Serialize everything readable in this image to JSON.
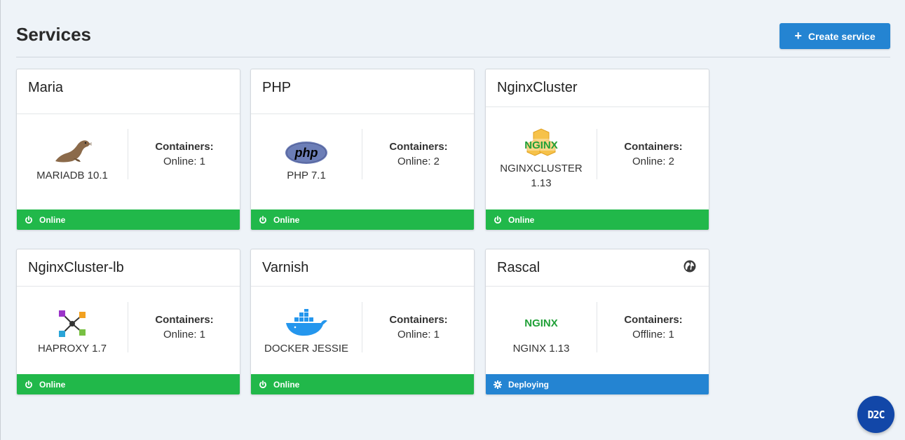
{
  "page": {
    "title": "Services"
  },
  "toolbar": {
    "create_label": "Create service",
    "create_icon": "plus-icon"
  },
  "colors": {
    "online": "#21b84a",
    "deploying": "#2484d2",
    "accent": "#2484d2",
    "fab": "#1247a8"
  },
  "cards": [
    {
      "title": "Maria",
      "logo_label": "MARIADB 10.1",
      "logo_icon": "mariadb-seal-icon",
      "containers_label": "Containers:",
      "containers_value": "Online: 1",
      "status": "Online",
      "status_icon": "power-icon"
    },
    {
      "title": "PHP",
      "logo_label": "PHP 7.1",
      "logo_icon": "php-logo-icon",
      "logo_text": "php",
      "containers_label": "Containers:",
      "containers_value": "Online: 2",
      "status": "Online",
      "status_icon": "power-icon"
    },
    {
      "title": "NginxCluster",
      "logo_label": "NGINXCLUSTER 1.13",
      "logo_icon": "nginx-cluster-logo-icon",
      "logo_text": "NGINX",
      "containers_label": "Containers:",
      "containers_value": "Online: 2",
      "status": "Online",
      "status_icon": "power-icon"
    },
    {
      "title": "NginxCluster-lb",
      "logo_label": "HAPROXY 1.7",
      "logo_icon": "haproxy-logo-icon",
      "containers_label": "Containers:",
      "containers_value": "Online: 1",
      "status": "Online",
      "status_icon": "power-icon"
    },
    {
      "title": "Varnish",
      "logo_label": "DOCKER JESSIE",
      "logo_icon": "docker-whale-icon",
      "containers_label": "Containers:",
      "containers_value": "Online: 1",
      "status": "Online",
      "status_icon": "power-icon"
    },
    {
      "title": "Rascal",
      "logo_label": "NGINX 1.13",
      "logo_icon": "nginx-logo-icon",
      "logo_text": "NGINX",
      "containers_label": "Containers:",
      "containers_value": "Offline: 1",
      "status": "Deploying",
      "status_icon": "gear-icon",
      "title_icon": "globe-icon"
    }
  ],
  "fab": {
    "label": "D2C"
  }
}
